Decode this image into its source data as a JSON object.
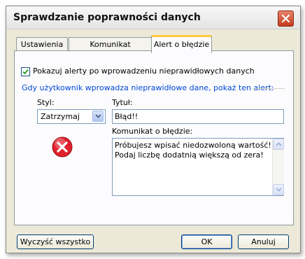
{
  "window": {
    "title": "Sprawdzanie poprawności danych"
  },
  "tabs": [
    {
      "label": "Ustawienia"
    },
    {
      "label": "Komunikat wejściowy"
    },
    {
      "label": "Alert o błędzie"
    }
  ],
  "alert_tab": {
    "show_alert_checkbox": {
      "label": "Pokazuj alerty po wprowadzeniu nieprawidłowych danych",
      "checked": true
    },
    "group_label": "Gdy użytkownik wprowadza nieprawidłowe dane, pokaż ten alert:",
    "style": {
      "label": "Styl:",
      "value": "Zatrzymaj"
    },
    "title": {
      "label": "Tytuł:",
      "value": "Błąd!!"
    },
    "message": {
      "label": "Komunikat o błędzie:",
      "lines": [
        "Próbujesz wpisać niedozwoloną wartość!",
        "Podaj liczbę dodatnią większą od zera!"
      ]
    },
    "icon": "error-icon"
  },
  "buttons": {
    "clear": "Wyczyść wszystko",
    "ok": "OK",
    "cancel": "Anuluj"
  },
  "colors": {
    "accent_tab": "#ffc83c",
    "group_label": "#0046d5",
    "error_icon": "#e0202c"
  }
}
